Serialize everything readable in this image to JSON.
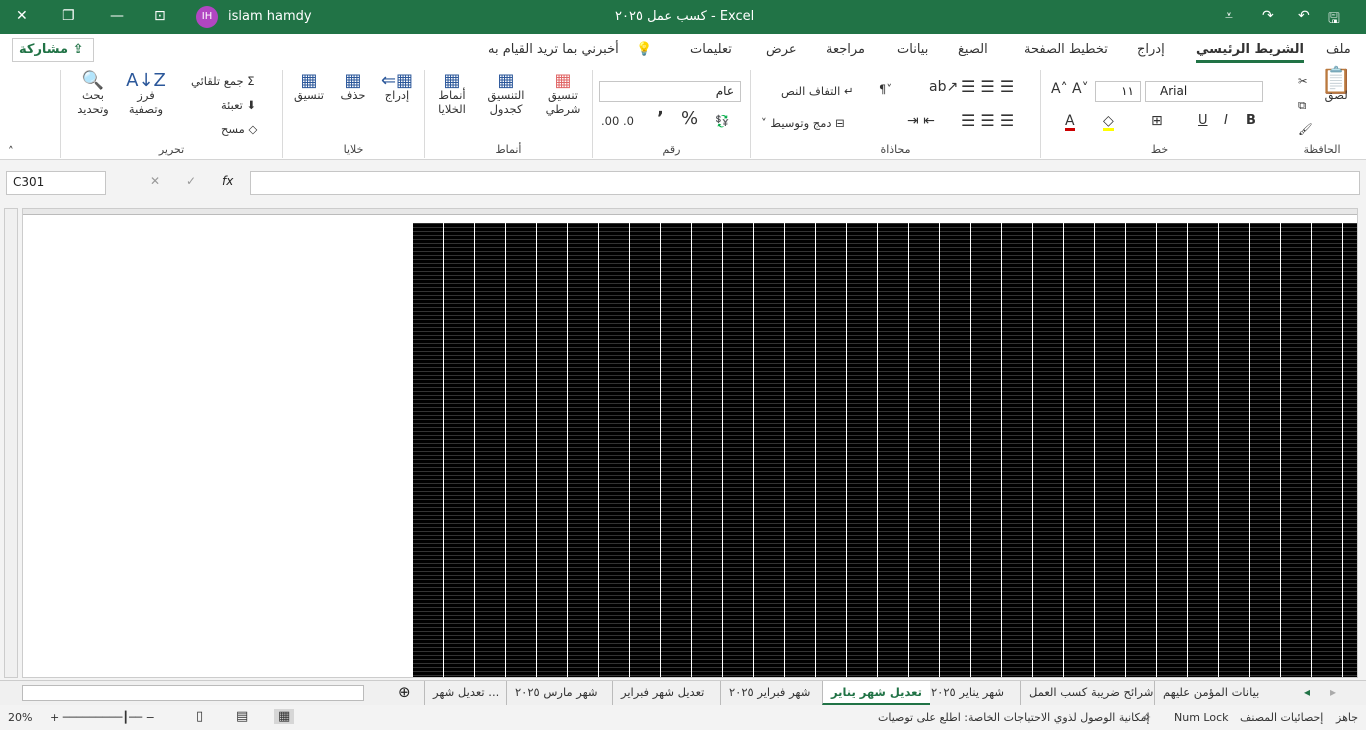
{
  "title_bar": {
    "title": "كسب عمل ٢٠٢٥ - Excel",
    "user_initials": "IH",
    "user_name": "islam hamdy"
  },
  "tabs": [
    "ملف",
    "الشريط الرئيسي",
    "إدراج",
    "تخطيط الصفحة",
    "الصيغ",
    "بيانات",
    "مراجعة",
    "عرض",
    "تعليمات"
  ],
  "active_tab": "الشريط الرئيسي",
  "tell_me": "أخبرني بما تريد القيام به",
  "share": "مشاركة",
  "ribbon": {
    "clipboard": {
      "label": "الحافظة",
      "paste": "لصق"
    },
    "font": {
      "label": "خط",
      "font_name": "Arial",
      "font_size": "١١",
      "bold": "B",
      "italic": "I",
      "underline": "U"
    },
    "alignment": {
      "label": "محاذاة",
      "wrap": "التفاف النص",
      "merge": "دمج وتوسيط"
    },
    "number": {
      "label": "رقم",
      "format": "عام",
      "percent": "%",
      "comma": "٬"
    },
    "styles": {
      "label": "أنماط",
      "conditional": "تنسيق شرطي",
      "table": "التنسيق كجدول",
      "cell_styles": "أنماط الخلايا"
    },
    "cells": {
      "label": "خلايا",
      "insert": "إدراج",
      "delete": "حذف",
      "format": "تنسيق"
    },
    "editing": {
      "label": "تحرير",
      "autosum": "جمع تلقائي",
      "fill": "تعبئة",
      "clear": "مسح",
      "sort": "فرز وتصفية",
      "find": "بحث وتحديد"
    }
  },
  "formula_bar": {
    "name_box": "C301",
    "fx": "fx",
    "value": ""
  },
  "sheet_tabs": [
    "بيانات المؤمن عليهم",
    "شرائح ضريبة كسب العمل",
    "شهر يناير ٢٠٢٥",
    "تعديل شهر يناير",
    "شهر فبراير ٢٠٢٥",
    "تعديل شهر فبراير",
    "شهر مارس ٢٠٢٥",
    "تعديل شهر ..."
  ],
  "active_sheet": "تعديل شهر يناير",
  "status": {
    "ready": "جاهز",
    "stats": "إحصائيات المصنف",
    "numlock": "Num Lock",
    "accessibility": "إمكانية الوصول لذوي الاحتياجات الخاصة: اطلع على توصيات",
    "zoom": "20%"
  },
  "colors": {
    "accent": "#217346"
  }
}
